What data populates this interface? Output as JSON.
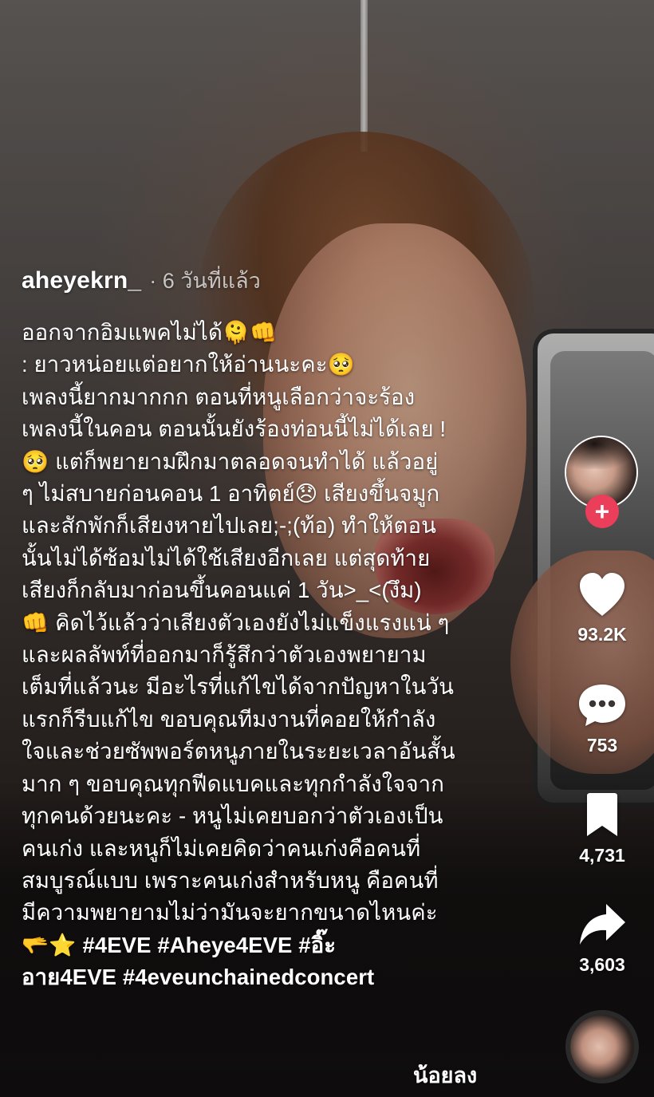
{
  "post": {
    "username": "aheyekrn_",
    "time": "· 6 วันที่แล้ว",
    "caption_lines": [
      "ออกจากอิมแพคไม่ได้🫠👊",
      ": ยาวหน่อยแต่อยากให้อ่านนะคะ🥺",
      "เพลงนี้ยากมากกก ตอนที่หนูเลือกว่าจะร้อง",
      "เพลงนี้ในคอน ตอนนั้นยังร้องท่อนนี้ไม่ได้เลย !",
      "🥺 แต่ก็พยายามฝึกมาตลอดจนทำได้ แล้วอยู่",
      "ๆ ไม่สบายก่อนคอน 1 อาทิตย์😞 เสียงขึ้นจมูก",
      "และสักพักก็เสียงหายไปเลย;-;(ท้อ) ทำให้ตอน",
      "นั้นไม่ได้ซ้อมไม่ได้ใช้เสียงอีกเลย แต่สุดท้าย",
      "เสียงก็กลับมาก่อนขึ้นคอนแค่ 1 วัน>_<(งึม)",
      "👊 คิดไว้แล้วว่าเสียงตัวเองยังไม่แข็งแรงแน่ ๆ",
      "และผลลัพท์ที่ออกมาก็รู้สึกว่าตัวเองพยายาม",
      "เต็มที่แล้วนะ มีอะไรที่แก้ไขได้จากปัญหาในวัน",
      "แรกก็รีบแก้ไข ขอบคุณทีมงานที่คอยให้กำลัง",
      "ใจและช่วยซัพพอร์ตหนูภายในระยะเวลาอันสั้น",
      "มาก ๆ ขอบคุณทุกฟีดแบคและทุกกำลังใจจาก",
      "ทุกคนด้วยนะคะ - หนูไม่เคยบอกว่าตัวเองเป็น",
      "คนเก่ง และหนูก็ไม่เคยคิดว่าคนเก่งคือคนที่",
      "สมบูรณ์แบบ เพราะคนเก่งสำหรับหนู คือคนที่",
      "มีความพยายามไม่ว่ามันจะยากขนาดไหนค่ะ"
    ],
    "tags_line1_prefix": "🫳⭐",
    "hashtags_line1": [
      "#4EVE",
      "#Aheye4EVE",
      "#อิ๊ะ"
    ],
    "hashtags_line2": [
      "อาย4EVE",
      "#4eveunchainedconcert"
    ],
    "see_less": "น้อยลง"
  },
  "actions": {
    "follow_symbol": "+",
    "likes": "93.2K",
    "comments": "753",
    "saves": "4,731",
    "shares": "3,603"
  },
  "icons": {
    "like": "heart-icon",
    "comment": "comment-bubble-icon",
    "save": "bookmark-icon",
    "share": "share-arrow-icon",
    "follow": "plus-icon"
  },
  "colors": {
    "follow_accent": "#ea3e5b",
    "text": "#ffffff"
  }
}
